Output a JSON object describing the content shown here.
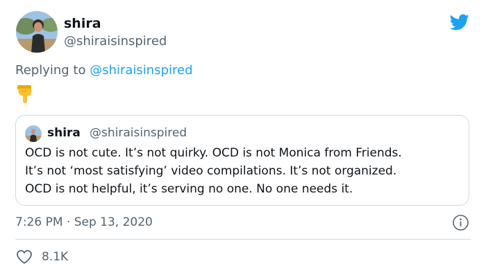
{
  "tweet": {
    "author_name": "shira",
    "author_handle": "@shiraisinspired",
    "replying_prefix": "Replying to ",
    "replying_handle": "@shiraisinspired",
    "emoji": "👇",
    "timestamp": "7:26 PM · Sep 13, 2020",
    "like_count": "8.1K"
  },
  "quoted_tweet": {
    "author_name": "shira",
    "author_handle": "@shiraisinspired",
    "text_lines": [
      "OCD is not cute. It’s not quirky. OCD is not Monica from Friends.",
      "It’s not ‘most satisfying’ video compilations. It’s not organized.",
      "OCD is not helpful, it’s serving no one. No one needs it."
    ]
  },
  "icons": {
    "brand": "twitter-bird-icon",
    "info": "info-icon",
    "like": "heart-icon"
  },
  "colors": {
    "brand_blue": "#1da1f2",
    "secondary_text": "#536471",
    "border": "#cfd9de"
  }
}
